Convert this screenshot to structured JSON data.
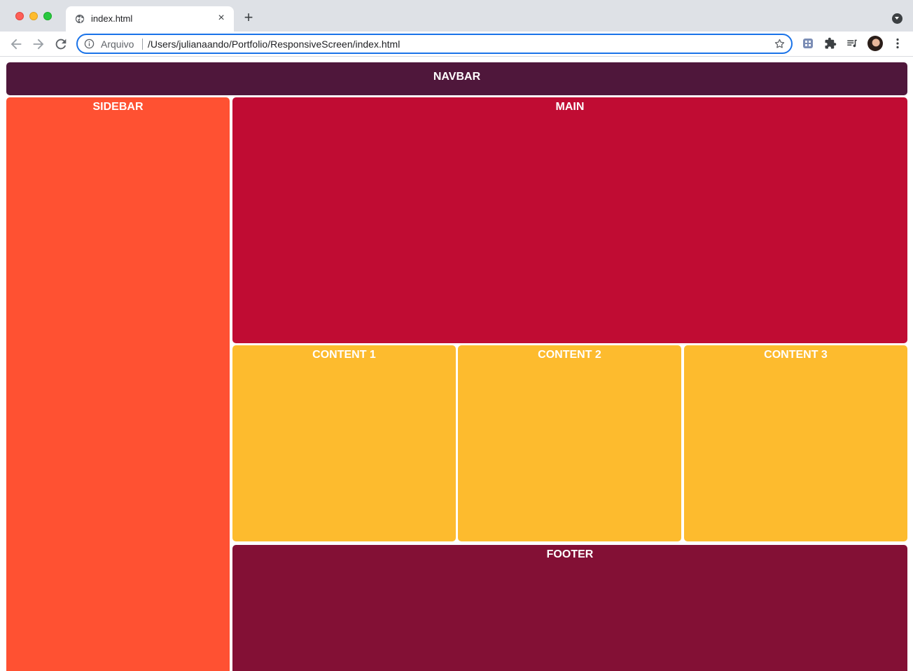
{
  "browser": {
    "tab": {
      "title": "index.html",
      "favicon": "globe-icon"
    },
    "new_tab_symbol": "+",
    "close_symbol": "×",
    "address_bar": {
      "scheme_label": "Arquivo",
      "url": "/Users/julianaando/Portfolio/ResponsiveScreen/index.html"
    },
    "colors": {
      "focus_ring": "#1a73e8",
      "tab_strip": "#dee1e6"
    }
  },
  "page": {
    "navbar": {
      "label": "NAVBAR",
      "color": "#4f173b"
    },
    "sidebar": {
      "label": "SIDEBAR",
      "color": "#ff5132"
    },
    "main": {
      "label": "MAIN",
      "color": "#c00c33"
    },
    "contents": [
      {
        "label": "CONTENT 1",
        "color": "#fdbb2e"
      },
      {
        "label": "CONTENT 2",
        "color": "#fdbb2e"
      },
      {
        "label": "CONTENT 3",
        "color": "#fdbb2e"
      }
    ],
    "footer": {
      "label": "FOOTER",
      "color": "#831035"
    }
  }
}
